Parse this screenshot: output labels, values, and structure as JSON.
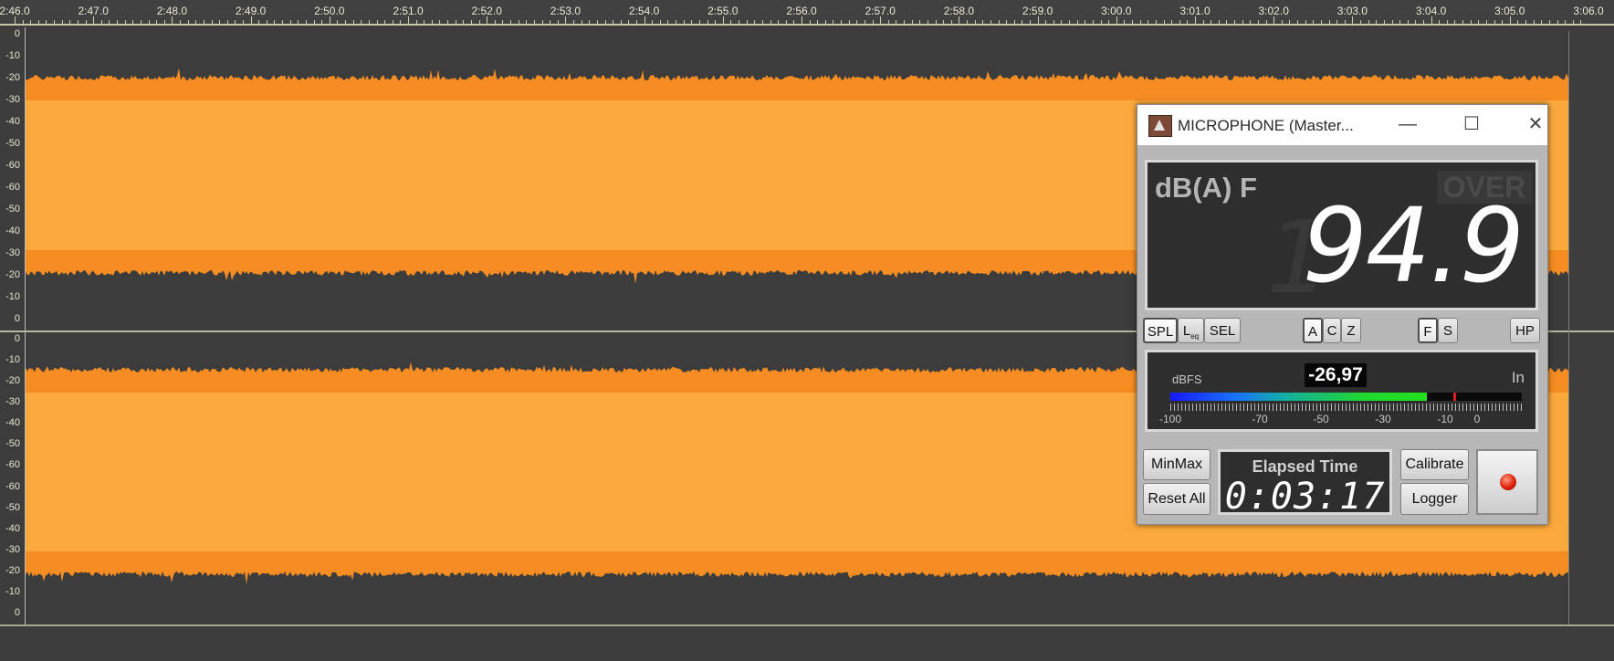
{
  "timeline": {
    "labels": [
      "2:46.0",
      "2:47.0",
      "2:48.0",
      "2:49.0",
      "2:50.0",
      "2:51.0",
      "2:52.0",
      "2:53.0",
      "2:54.0",
      "2:55.0",
      "2:56.0",
      "2:57.0",
      "2:58.0",
      "2:59.0",
      "3:00.0",
      "3:01.0",
      "3:02.0",
      "3:03.0",
      "3:04.0",
      "3:05.0",
      "3:06.0"
    ]
  },
  "tracks": {
    "y_labels": [
      "0",
      "-10",
      "-20",
      "-30",
      "-40",
      "-50",
      "-60",
      "-60",
      "-50",
      "-40",
      "-30",
      "-20",
      "-10",
      "0"
    ],
    "waveform_color": "#fba93c",
    "waveform_edge_color": "#f58d22"
  },
  "meter": {
    "window_title": "MICROPHONE (Master...",
    "icons": {
      "app": "spl-meter-app-icon",
      "minimize": "minimize-icon",
      "maximize": "maximize-icon",
      "close": "close-icon",
      "record": "record-icon"
    },
    "mode_label": "dB(A) F",
    "over_label": "OVER",
    "reading": "94.9",
    "reading_ghost": "1",
    "buttons": {
      "spl": "SPL",
      "leq": "L",
      "leq_sub": "eq",
      "sel": "SEL",
      "a": "A",
      "c": "C",
      "z": "Z",
      "f": "F",
      "s": "S",
      "hp": "HP",
      "minmax": "MinMax",
      "reset_all": "Reset All",
      "calibrate": "Calibrate",
      "logger": "Logger"
    },
    "dbfs": {
      "label": "dBFS",
      "value": "-26,97",
      "input_label": "In",
      "level_fraction": 0.73,
      "peak_fraction": 0.805,
      "scale": [
        "-100",
        "-70",
        "-50",
        "-30",
        "-10",
        "0"
      ]
    },
    "elapsed": {
      "label": "Elapsed Time",
      "value": "0:03:17"
    }
  }
}
